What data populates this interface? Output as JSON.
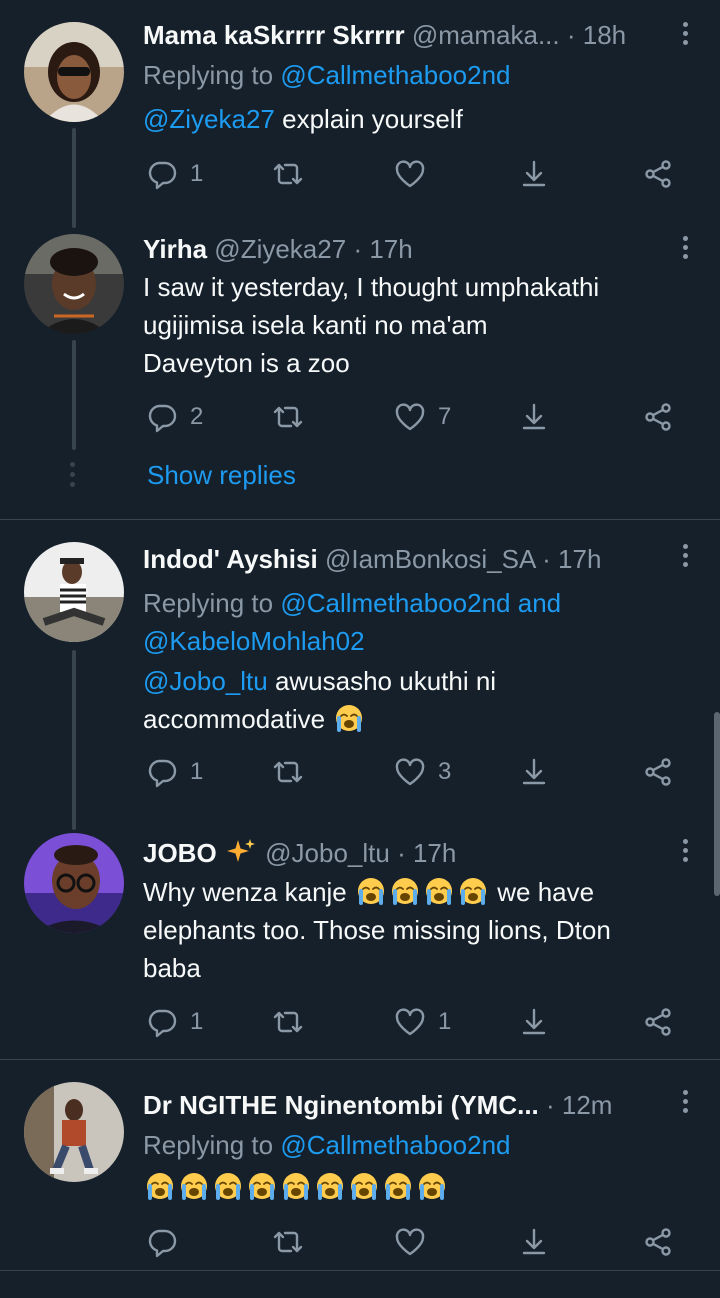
{
  "colors": {
    "background": "#15202b",
    "link": "#1d9bf0",
    "muted": "#8b98a5",
    "divider": "#38444d"
  },
  "tweets": [
    {
      "name": "Mama kaSkrrrr Skrrrr",
      "handle": "@mamaka...",
      "time": "· 18h",
      "replying_label": "Replying to",
      "replying_to": "@Callmethaboo2nd",
      "mention": "@Ziyeka27",
      "text": "explain yourself",
      "replies": "1",
      "retweets": "",
      "likes": ""
    },
    {
      "name": "Yirha",
      "handle": "@Ziyeka27",
      "time": "· 17h",
      "text_lines": [
        "I saw it yesterday, I thought umphakathi",
        "ugijimisa isela kanti no ma'am",
        "Daveyton is a zoo"
      ],
      "replies": "2",
      "retweets": "",
      "likes": "7",
      "show_replies": "Show replies"
    },
    {
      "name": "Indod' Ayshisi",
      "handle": "@IamBonkosi_SA",
      "time": "· 17h",
      "replying_label": "Replying to",
      "replying_to": "@Callmethaboo2nd and",
      "replying_to_2": "@KabeloMohlah02",
      "mention": "@Jobo_ltu",
      "text": "awusasho ukuthi ni",
      "text_2": "accommodative",
      "emoji": "loudly-crying-face",
      "replies": "1",
      "retweets": "",
      "likes": "3"
    },
    {
      "name": "JOBO",
      "badge": "sparkles-emoji",
      "handle": "@Jobo_ltu",
      "time": "· 17h",
      "text_a": "Why wenza kanje",
      "text_b": "we have",
      "text_lines": [
        "elephants too. Those missing lions, Dton",
        "baba"
      ],
      "replies": "1",
      "retweets": "",
      "likes": "1"
    },
    {
      "name": "Dr NGITHE Nginentombi (YMC...",
      "handle": "",
      "time": "· 12m",
      "replying_label": "Replying to",
      "replying_to": "@Callmethaboo2nd",
      "emoji_count": "9",
      "replies": "",
      "retweets": "",
      "likes": ""
    }
  ],
  "icons": [
    "reply-icon",
    "retweet-icon",
    "like-icon",
    "bookmark-icon",
    "share-icon",
    "more-icon"
  ]
}
